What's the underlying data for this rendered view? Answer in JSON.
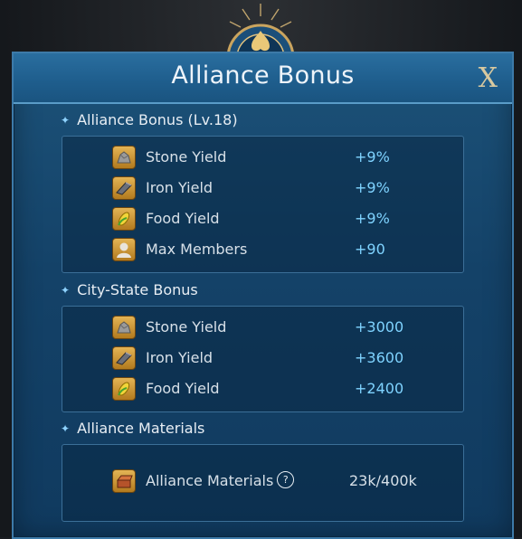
{
  "window": {
    "title": "Alliance Bonus",
    "close_label": "X"
  },
  "sections": [
    {
      "heading": "Alliance Bonus (Lv.18)",
      "rows": [
        {
          "icon": "stone-icon",
          "label": "Stone Yield",
          "value": "+9%"
        },
        {
          "icon": "iron-icon",
          "label": "Iron Yield",
          "value": "+9%"
        },
        {
          "icon": "food-icon",
          "label": "Food Yield",
          "value": "+9%"
        },
        {
          "icon": "member-icon",
          "label": "Max Members",
          "value": "+90"
        }
      ]
    },
    {
      "heading": "City-State Bonus",
      "rows": [
        {
          "icon": "stone-icon",
          "label": "Stone Yield",
          "value": "+3000"
        },
        {
          "icon": "iron-icon",
          "label": "Iron Yield",
          "value": "+3600"
        },
        {
          "icon": "food-icon",
          "label": "Food Yield",
          "value": "+2400"
        }
      ]
    },
    {
      "heading": "Alliance Materials",
      "rows": [
        {
          "icon": "materials-icon",
          "label": "Alliance Materials",
          "value": "23k/400k",
          "help": "?"
        }
      ]
    }
  ],
  "colors": {
    "accent": "#7fd3ff",
    "panel": "#144268",
    "title_bar": "#1e5d8c",
    "close": "#d8c9a0"
  }
}
